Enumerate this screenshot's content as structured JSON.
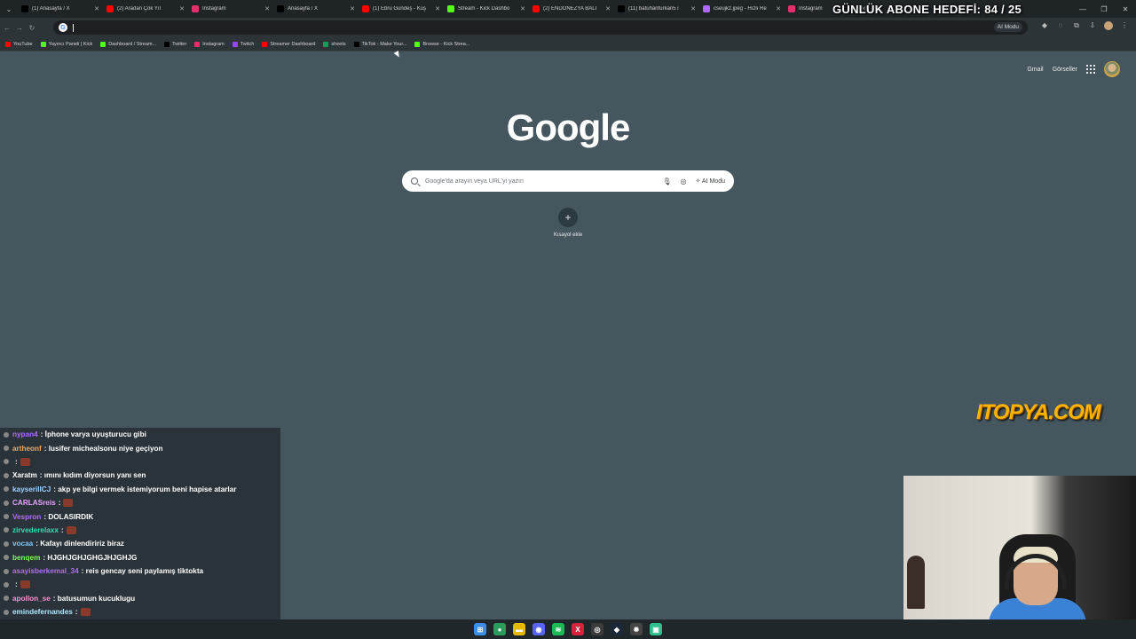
{
  "overlay": {
    "goal_text": "GÜNLÜK ABONE HEDEFİ: 84 / 25",
    "sponsor_logo": "ITOPYA.COM"
  },
  "tabs": [
    {
      "title": "(1) Anasayfa / X",
      "icon": "x-icon",
      "color": "#000000"
    },
    {
      "title": "(2) Aradan Çok Yıl",
      "icon": "youtube-icon",
      "color": "#ff0000"
    },
    {
      "title": "Instagram",
      "icon": "instagram-icon",
      "color": "#e1306c"
    },
    {
      "title": "Anasayfa / X",
      "icon": "x-icon",
      "color": "#000000"
    },
    {
      "title": "(1) Ebru Gündeş - Kuş",
      "icon": "youtube-icon",
      "color": "#ff0000"
    },
    {
      "title": "Stream - Kick Dashbo",
      "icon": "kick-icon",
      "color": "#53fc18"
    },
    {
      "title": "(2) ENDONEZYA BALI",
      "icon": "youtube-icon",
      "color": "#ff0000"
    },
    {
      "title": "(11) batuhanfurkan5 i",
      "icon": "x-icon",
      "color": "#000000"
    },
    {
      "title": "cseujkz.jpeg - Hızlı Re",
      "icon": "image-icon",
      "color": "#b066ff"
    },
    {
      "title": "Instagram",
      "icon": "instagram-icon",
      "color": "#e1306c"
    }
  ],
  "toolbar": {
    "omnibox_ai": "AI Modu"
  },
  "bookmarks": [
    {
      "label": "YouTube",
      "icon": "youtube-icon",
      "color": "#ff0000"
    },
    {
      "label": "Yayıncı Paneli | Kick",
      "icon": "kick-icon",
      "color": "#53fc18"
    },
    {
      "label": "Dashboard / Stream...",
      "icon": "kick-icon",
      "color": "#53fc18"
    },
    {
      "label": "Twitter",
      "icon": "x-icon",
      "color": "#000000"
    },
    {
      "label": "Instagram",
      "icon": "instagram-icon",
      "color": "#e1306c"
    },
    {
      "label": "Twitch",
      "icon": "twitch-icon",
      "color": "#9146ff"
    },
    {
      "label": "Streamer Dashboard",
      "icon": "youtube-icon",
      "color": "#ff0000"
    },
    {
      "label": "sheets",
      "icon": "sheets-icon",
      "color": "#0f9d58"
    },
    {
      "label": "TikTok - Make Your...",
      "icon": "tiktok-icon",
      "color": "#000000"
    },
    {
      "label": "Browse - Kick Strea...",
      "icon": "kick-icon",
      "color": "#53fc18"
    }
  ],
  "ntp": {
    "gmail": "Gmail",
    "images": "Görseller",
    "logo": "Google",
    "search_placeholder": "Google'da arayın veya URL'yi yazın",
    "ai_mode": "AI Modu",
    "add_shortcut": "Kısayol ekle"
  },
  "chat": [
    {
      "user": "nypan4",
      "color": "#b06cff",
      "text": ": İphone varya uyuşturucu gibi",
      "emote": false
    },
    {
      "user": "artheonf",
      "color": "#ffa64d",
      "text": ": lusifer michealsonu niye geçiyon",
      "emote": false
    },
    {
      "user": "",
      "color": "#e0213c",
      "text": ":",
      "emote": true
    },
    {
      "user": "Xaratm",
      "color": "#ffffff",
      "text": ": ımını kıdım diyorsun yanı sen",
      "emote": false
    },
    {
      "user": "kayserilICJ",
      "color": "#9fd0ff",
      "text": ": akp ye bilgi vermek istemiyorum beni hapise atarlar",
      "emote": false
    },
    {
      "user": "CARLASreis",
      "color": "#e5a3ff",
      "text": ":",
      "emote": true
    },
    {
      "user": "Vespron",
      "color": "#b06cff",
      "text": ": DOLASIRDIK",
      "emote": false
    },
    {
      "user": "zirvederelaxx",
      "color": "#2fe0b0",
      "text": ":",
      "emote": true
    },
    {
      "user": "vocaa",
      "color": "#7ec8ff",
      "text": ": Kafayı dinlendiririz biraz",
      "emote": false
    },
    {
      "user": "benqem",
      "color": "#7cff5c",
      "text": ": HJGHJGHJGHGJHJGHJG",
      "emote": false
    },
    {
      "user": "asayisberkemal_34",
      "color": "#b06cff",
      "text": ": reis gencay seni paylamış tiktokta",
      "emote": false
    },
    {
      "user": "",
      "color": "#e0213c",
      "text": ":",
      "emote": true
    },
    {
      "user": "apollon_se",
      "color": "#ff8fd6",
      "text": ": batusumun kucuklugu",
      "emote": false
    },
    {
      "user": "emindefernandes",
      "color": "#aee8ff",
      "text": ":",
      "emote": true
    }
  ],
  "taskbar": [
    {
      "icon": "windows-icon",
      "color": "#3a8ee6",
      "glyph": "⊞"
    },
    {
      "icon": "chrome-icon",
      "color": "#2a9d5c",
      "glyph": "●"
    },
    {
      "icon": "folder-icon",
      "color": "#e6b800",
      "glyph": "▬"
    },
    {
      "icon": "discord-icon",
      "color": "#5865f2",
      "glyph": "◉"
    },
    {
      "icon": "spotify-icon",
      "color": "#1db954",
      "glyph": "≋"
    },
    {
      "icon": "xsplit-icon",
      "color": "#d6223a",
      "glyph": "X"
    },
    {
      "icon": "obs-icon",
      "color": "#3b3b3b",
      "glyph": "◎"
    },
    {
      "icon": "steam-icon",
      "color": "#1b2838",
      "glyph": "◆"
    },
    {
      "icon": "settings-icon",
      "color": "#444444",
      "glyph": "✹"
    },
    {
      "icon": "app-icon",
      "color": "#2fbf8f",
      "glyph": "▣"
    }
  ]
}
